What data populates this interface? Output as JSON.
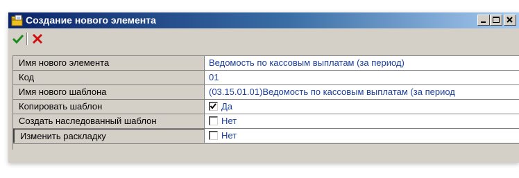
{
  "window": {
    "title": "Создание нового элемента",
    "icon": "folder-document-icon"
  },
  "window_buttons": [
    {
      "name": "minimize-button",
      "icon": "minimize-icon"
    },
    {
      "name": "maximize-button",
      "icon": "maximize-icon"
    },
    {
      "name": "close-button",
      "icon": "close-icon"
    }
  ],
  "toolbar": {
    "ok_icon": "checkmark-icon",
    "cancel_icon": "cross-icon",
    "ok_color": "#1a8a1a",
    "cancel_color": "#d01010"
  },
  "properties": [
    {
      "label": "Имя нового элемента",
      "value": "Ведомость по кассовым выплатам (за период)",
      "type": "text"
    },
    {
      "label": "Код",
      "value": "01",
      "type": "text"
    },
    {
      "label": "Имя нового шаблона",
      "value": "(03.15.01.01)Ведомость по кассовым выплатам (за период",
      "type": "text"
    },
    {
      "label": "Копировать шаблон",
      "value": "Да",
      "type": "checkbox",
      "checked": true
    },
    {
      "label": "Создать наследованный шаблон",
      "value": "Нет",
      "type": "checkbox",
      "checked": false
    },
    {
      "label": "Изменить раскладку",
      "value": "Нет",
      "type": "checkbox",
      "checked": false
    }
  ],
  "colors": {
    "title_gradient_start": "#0a246a",
    "title_gradient_end": "#a6caf0",
    "value_text": "#1a3f9c",
    "face": "#d4d0c8"
  }
}
